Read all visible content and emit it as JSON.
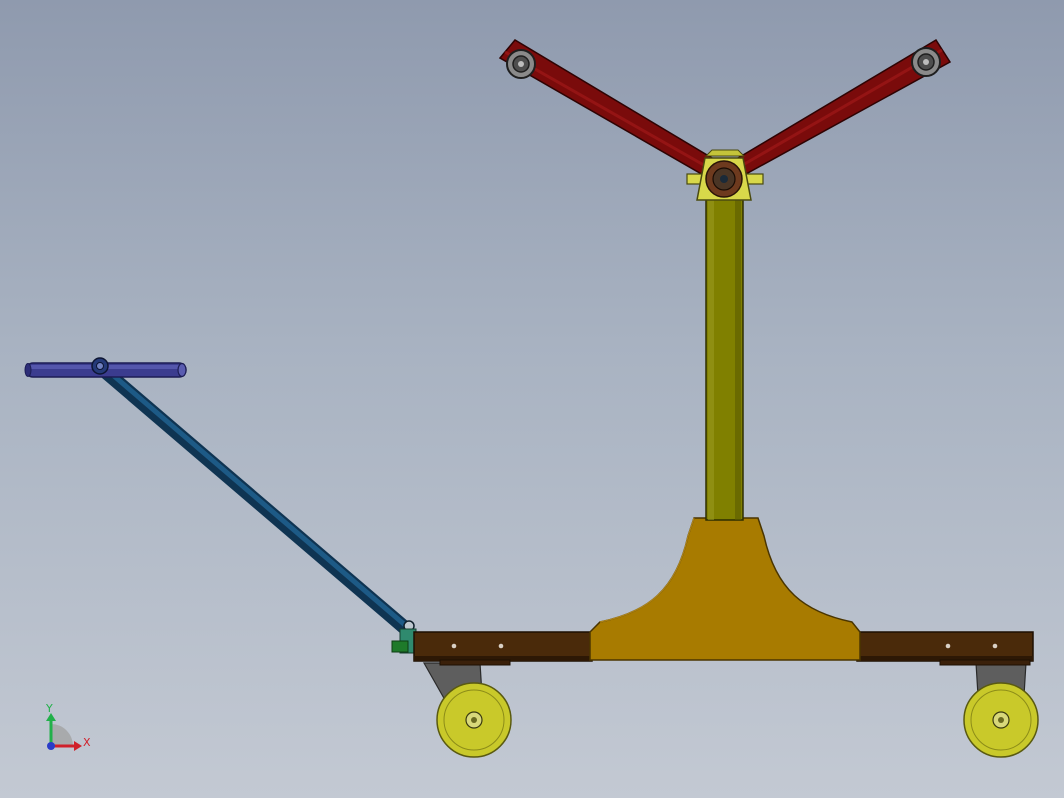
{
  "view": {
    "background_top": "#8f9aae",
    "background_bottom": "#c3c9d3"
  },
  "triad": {
    "x_label": "X",
    "y_label": "Y",
    "x_color": "#d0202a",
    "y_color": "#22b04a",
    "z_color": "#2a3cc8"
  },
  "parts": {
    "handle_grip_color": "#3b3c8f",
    "handle_rod_color": "#18466b",
    "arm_color": "#7a0b0b",
    "hub_color": "#d8d84a",
    "column_color": "#808000",
    "base_color": "#a87b00",
    "frame_color": "#4a2a0a",
    "wheel_color": "#c9c92a",
    "caster_color": "#5e5e5e"
  }
}
